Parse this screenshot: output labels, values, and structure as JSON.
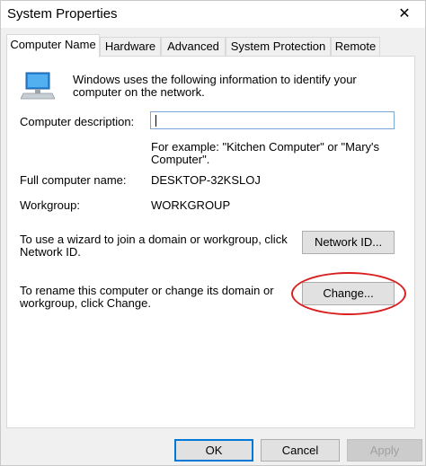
{
  "window": {
    "title": "System Properties",
    "close_glyph": "✕"
  },
  "tabs": [
    {
      "label": "Computer Name",
      "active": true
    },
    {
      "label": "Hardware",
      "active": false
    },
    {
      "label": "Advanced",
      "active": false
    },
    {
      "label": "System Protection",
      "active": false
    },
    {
      "label": "Remote",
      "active": false
    }
  ],
  "panel": {
    "intro_line1": "Windows uses the following information to identify your",
    "intro_line2": "computer on the network.",
    "icon": "computer-icon",
    "description_label": "Computer description:",
    "description_value": "",
    "example_line1": "For example: \"Kitchen Computer\" or \"Mary's",
    "example_line2": "Computer\".",
    "full_name_label": "Full computer name:",
    "full_name_value": "DESKTOP-32KSLOJ",
    "workgroup_label": "Workgroup:",
    "workgroup_value": "WORKGROUP",
    "network_text_line1": "To use a wizard to join a domain or workgroup, click",
    "network_text_line2": "Network ID.",
    "network_button": "Network ID...",
    "rename_text_line1": "To rename this computer or change its domain or",
    "rename_text_line2": "workgroup, click Change.",
    "change_button": "Change..."
  },
  "footer": {
    "ok": "OK",
    "cancel": "Cancel",
    "apply": "Apply"
  },
  "colors": {
    "accent": "#0078d7",
    "highlight": "#d91f1f"
  }
}
